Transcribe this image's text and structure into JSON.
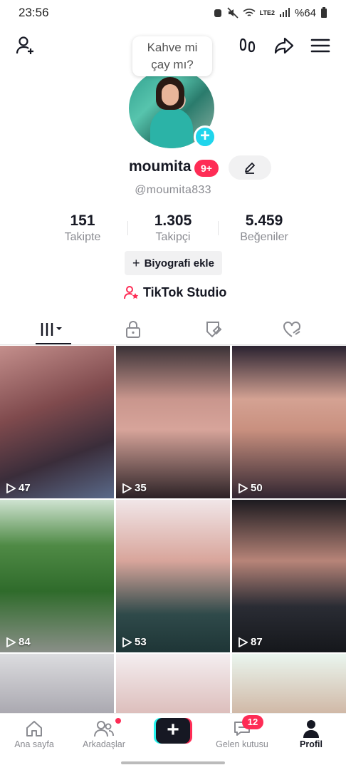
{
  "status_bar": {
    "time": "23:56",
    "battery": "%64",
    "network": "LTE2"
  },
  "header": {
    "bubble_text_line1": "Kahve mi",
    "bubble_text_line2": "çay mı?"
  },
  "profile": {
    "username": "moumita",
    "notification_badge": "9+",
    "handle": "@moumita833",
    "stats": [
      {
        "value": "151",
        "label": "Takipte"
      },
      {
        "value": "1.305",
        "label": "Takipçi"
      },
      {
        "value": "5.459",
        "label": "Beğeniler"
      }
    ],
    "bio_button": "Biyografi ekle",
    "studio_label": "TikTok Studio"
  },
  "tabs": [
    "videos-grid-icon",
    "lock-icon",
    "tagged-icon",
    "liked-icon"
  ],
  "videos": [
    {
      "views": "47"
    },
    {
      "views": "35"
    },
    {
      "views": "50"
    },
    {
      "views": "84"
    },
    {
      "views": "53"
    },
    {
      "views": "87"
    }
  ],
  "bottom_nav": {
    "home": "Ana sayfa",
    "friends": "Arkadaşlar",
    "inbox": "Gelen kutusu",
    "inbox_badge": "12",
    "profile": "Profil"
  },
  "colors": {
    "accent": "#fe2c55",
    "cyan": "#20d5ec",
    "text": "#161823",
    "muted": "#8a8b91"
  }
}
